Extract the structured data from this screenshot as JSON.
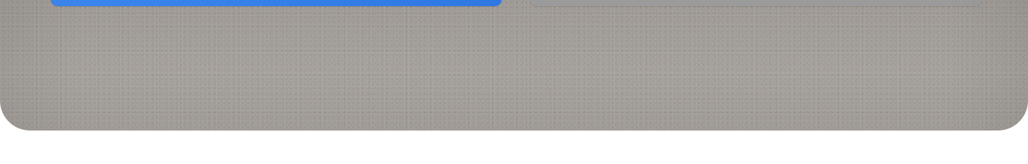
{
  "actions": {
    "primary_label": "",
    "secondary_label": ""
  },
  "colors": {
    "primary": "#3584EC",
    "secondary": "#9B9B9B",
    "panel": "#A29D98",
    "background": "#FFFFFF"
  }
}
